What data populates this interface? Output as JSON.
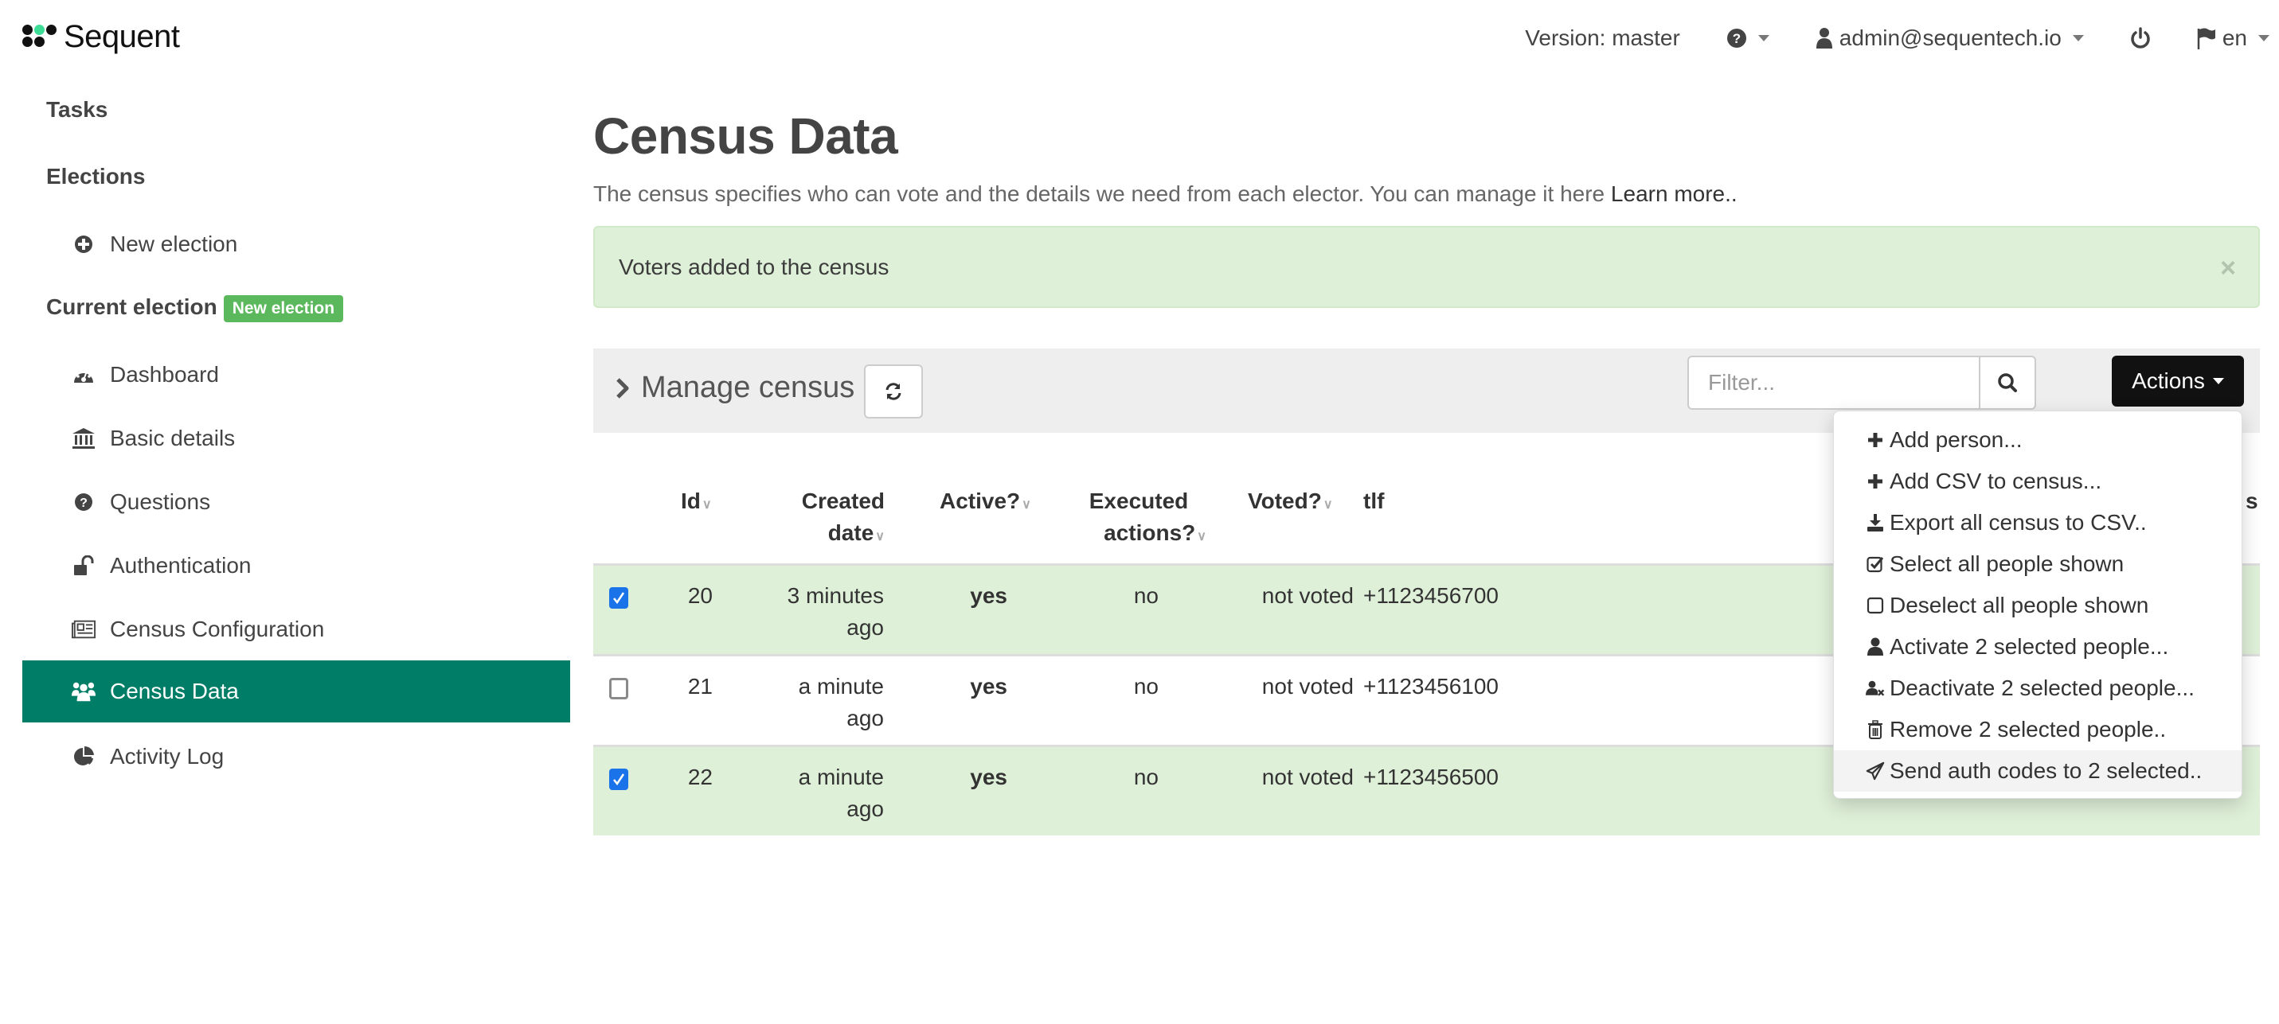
{
  "header": {
    "logo_text": "Sequent",
    "version": "Version: master",
    "help_icon": "question-circle-icon",
    "user_email": "admin@sequentech.io",
    "power_icon": "power-icon",
    "language": "en"
  },
  "sidebar": {
    "tasks": "Tasks",
    "elections": "Elections",
    "new_election": "New election",
    "current_election": "Current election",
    "current_election_badge": "New election",
    "items": [
      {
        "label": "Dashboard",
        "icon": "dashboard-icon"
      },
      {
        "label": "Basic details",
        "icon": "bank-icon"
      },
      {
        "label": "Questions",
        "icon": "question-circle-icon"
      },
      {
        "label": "Authentication",
        "icon": "unlock-icon"
      },
      {
        "label": "Census Configuration",
        "icon": "newspaper-icon"
      },
      {
        "label": "Census Data",
        "icon": "users-icon",
        "active": true
      },
      {
        "label": "Activity Log",
        "icon": "pie-chart-icon"
      }
    ]
  },
  "main": {
    "title": "Census Data",
    "subtitle": "The census specifies who can vote and the details we need from each elector. You can manage it here",
    "learn_more": "Learn more..",
    "alert": "Voters added to the census",
    "alert_close": "×",
    "panel_title": "Manage census",
    "filter_placeholder": "Filter...",
    "filter_value": "",
    "actions_label": "Actions"
  },
  "table": {
    "headers": {
      "id": "Id",
      "created_1": "Created",
      "created_2": "date",
      "active": "Active?",
      "executed_1": "Executed",
      "executed_2": "actions?",
      "voted": "Voted?",
      "tlf": "tlf",
      "hidden_tail": "s"
    },
    "rows": [
      {
        "selected": true,
        "id": "20",
        "created_1": "3 minutes",
        "created_2": "ago",
        "active": "yes",
        "executed": "no",
        "voted": "not voted",
        "tlf": "+1123456700"
      },
      {
        "selected": false,
        "id": "21",
        "created_1": "a minute",
        "created_2": "ago",
        "active": "yes",
        "executed": "no",
        "voted": "not voted",
        "tlf": "+1123456100"
      },
      {
        "selected": true,
        "id": "22",
        "created_1": "a minute",
        "created_2": "ago",
        "active": "yes",
        "executed": "no",
        "voted": "not voted",
        "tlf": "+1123456500"
      }
    ]
  },
  "actions_menu": [
    {
      "label": "Add person...",
      "icon": "plus-icon"
    },
    {
      "label": "Add CSV to census...",
      "icon": "plus-icon"
    },
    {
      "label": "Export all census to CSV..",
      "icon": "download-icon"
    },
    {
      "label": "Select all people shown",
      "icon": "check-square-icon"
    },
    {
      "label": "Deselect all people shown",
      "icon": "square-icon"
    },
    {
      "label": "Activate 2 selected people...",
      "icon": "user-icon"
    },
    {
      "label": "Deactivate 2 selected people...",
      "icon": "user-times-icon"
    },
    {
      "label": "Remove 2 selected people..",
      "icon": "trash-icon"
    },
    {
      "label": "Send auth codes to 2 selected..",
      "icon": "paper-plane-icon",
      "hovered": true
    }
  ],
  "colors": {
    "accent": "#007d66",
    "badge": "#5cb85c",
    "alert_bg": "#dff0d8",
    "actions_btn": "#111111",
    "checkbox": "#1a73e8"
  }
}
